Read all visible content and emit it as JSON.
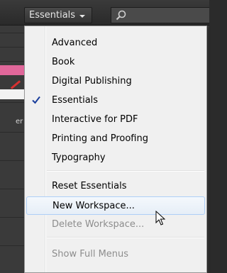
{
  "toolbar": {
    "workspace_button_label": "Essentials",
    "search_placeholder": ""
  },
  "side_panel": {
    "partial_text": "er"
  },
  "menu": {
    "items": [
      {
        "label": "Advanced",
        "checked": false,
        "enabled": true
      },
      {
        "label": "Book",
        "checked": false,
        "enabled": true
      },
      {
        "label": "Digital Publishing",
        "checked": false,
        "enabled": true
      },
      {
        "label": "Essentials",
        "checked": true,
        "enabled": true
      },
      {
        "label": "Interactive for PDF",
        "checked": false,
        "enabled": true
      },
      {
        "label": "Printing and Proofing",
        "checked": false,
        "enabled": true
      },
      {
        "label": "Typography",
        "checked": false,
        "enabled": true
      }
    ],
    "actions": [
      {
        "label": "Reset Essentials",
        "enabled": true
      },
      {
        "label": "New Workspace...",
        "enabled": true,
        "hovered": true
      },
      {
        "label": "Delete Workspace...",
        "enabled": false
      }
    ],
    "footer": [
      {
        "label": "Show Full Menus",
        "enabled": false
      }
    ]
  },
  "colors": {
    "menu_background": "#f0f0f0",
    "hover_border": "#aecff7",
    "checkmark": "#1a3e9c",
    "disabled_text": "#8d8d8d",
    "chrome_dark": "#2b2b2b"
  },
  "icons": {
    "search": "search-icon",
    "caret": "chevron-down-icon",
    "check": "checkmark-icon",
    "cursor": "mouse-pointer-icon"
  }
}
